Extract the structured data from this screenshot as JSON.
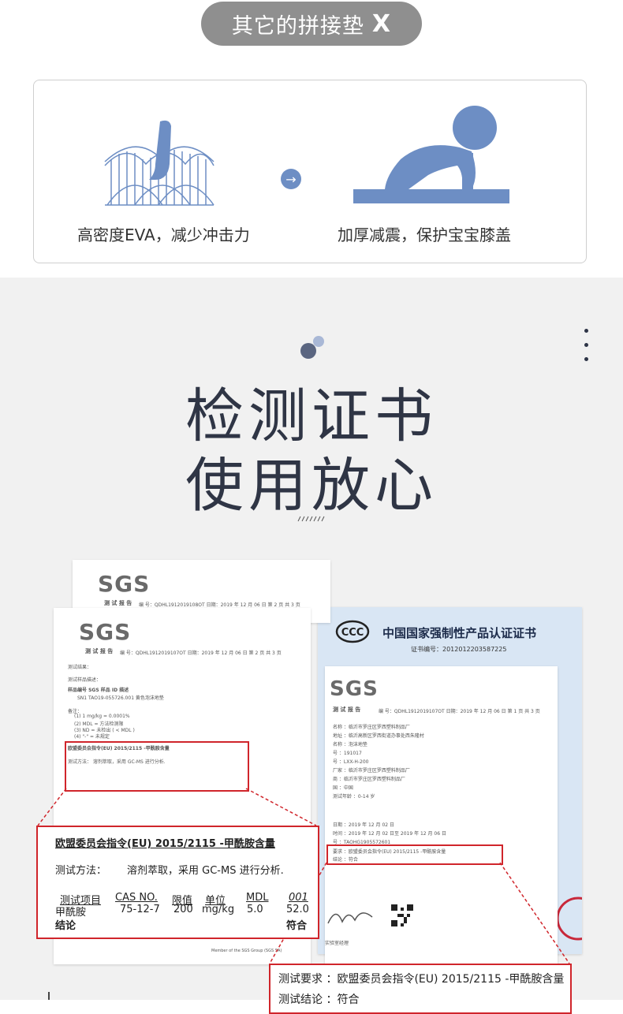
{
  "header": {
    "pill_label": "其它的拼接垫",
    "pill_x": "X"
  },
  "feature_card": {
    "left_caption": "高密度EVA，减少冲击力",
    "right_caption": "加厚减震，保护宝宝膝盖",
    "arrow_glyph": "→"
  },
  "section": {
    "title_line1": "检测证书",
    "title_line2": "使用放心"
  },
  "sgs_doc_back": {
    "logo": "SGS",
    "report_label": "测 试 报 告",
    "report_no": "编 号：QDHL1912019108OT   日期：2019 年 12 月 06 日       第 2 页 共 3 页"
  },
  "sgs_doc_front": {
    "logo": "SGS",
    "report_label": "测 试 报 告",
    "report_no": "编 号：QDHL1912019107OT   日期：2019 年 12 月 06 日       第 2 页 共 3 页",
    "lines": [
      "测试结果：",
      "测试样品描述：",
      "样品编号      SGS 样品 ID          描述",
      "SN1         TAO19-055726.001    黄色泡沫地垫",
      "备注：",
      "(1) 1 mg/kg = 0.0001%",
      "(2) MDL = 方法检测限",
      "(3) ND = 未检出 ( < MDL )",
      "(4) \"-\" = 未规定"
    ],
    "highlight": "欧盟委员会指令(EU) 2015/2115 -甲酰胺含量",
    "method": "测试方法：     溶剂萃取，采用 GC-MS 进行分析.",
    "footer": "Member of the SGS Group (SGS SA)"
  },
  "ccc_cert": {
    "title": "中国国家强制性产品认证证书",
    "cert_no": "证书编号：2012012203587225"
  },
  "sgs_doc_third": {
    "logo": "SGS",
    "report_label": "测 试 报 告",
    "report_no": "编 号：QDHL1912019107OT   日期：2019 年 12 月 06 日      第 1 页 共 3 页",
    "rows": [
      "名称     ：临沂市罗庄区罗西塑料制品厂",
      "地址     ：临沂高新区罗西街道办事处西朱隆村",
      "名称     ：泡沫地垫",
      "号       ：191017",
      "号       ：LXX-H-200",
      "厂家     ：临沂市罗庄区罗西塑料制品厂",
      "商       ：临沂市罗庄区罗西塑料制品厂",
      "国       ：中国",
      "测试年龄 ：0-14 岁",
      "日期     ：2019 年 12 月 02 日",
      "时间     ：2019 年 12 月 02 日至 2019 年 12 月 06 日",
      "号       ：TAOHG1905572601"
    ],
    "req": "要求     ：欧盟委员会指令(EU) 2015/2115 -甲酰胺含量",
    "concl": "结论     ：符合",
    "signer": "实验室经理"
  },
  "zoom_box_1": {
    "title": "欧盟委员会指令(EU) 2015/2115 -甲酰胺含量",
    "method_label": "测试方法：",
    "method_value": "溶剂萃取，采用 GC-MS 进行分析.",
    "headers": [
      "测试项目",
      "CAS NO.",
      "限值",
      "单位",
      "MDL",
      "001"
    ],
    "row": [
      "甲酰胺",
      "75-12-7",
      "200",
      "mg/kg",
      "5.0",
      "52.0"
    ],
    "conclusion_label": "结论",
    "conclusion_value": "符合"
  },
  "zoom_box_2": {
    "line1": "测试要求 ：欧盟委员会指令(EU) 2015/2115 -甲酰胺含量",
    "line2": "测试结论 ：符合"
  },
  "colors": {
    "accent_blue": "#6d8ec4",
    "red": "#d0252b",
    "title_dark": "#2f3545"
  }
}
